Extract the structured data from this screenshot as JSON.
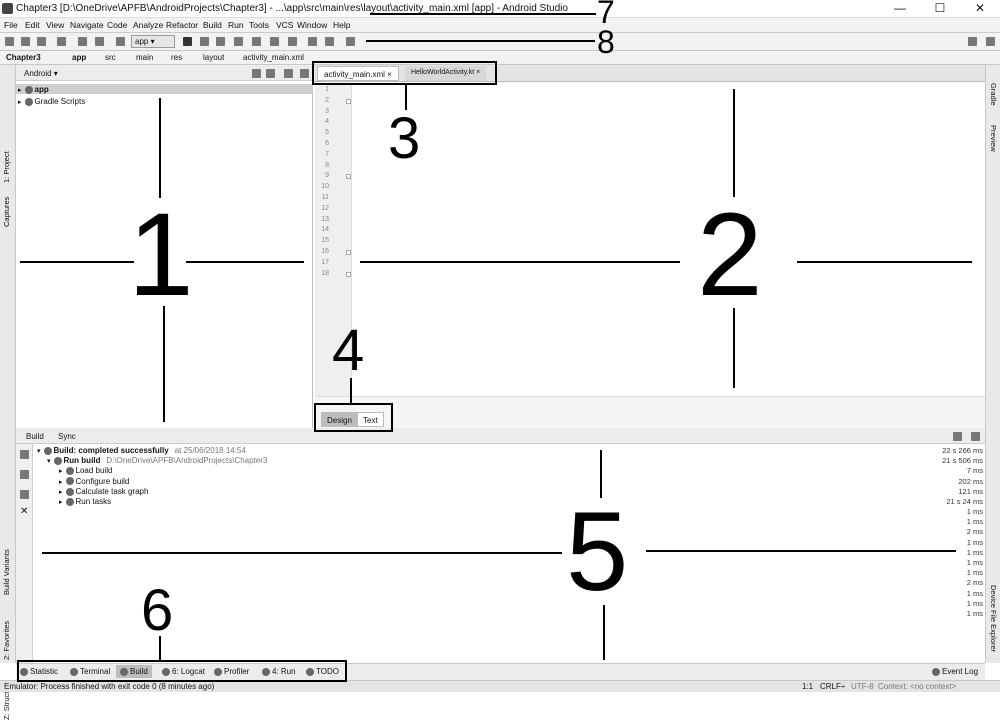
{
  "title_bar": {
    "title": "Chapter3 [D:\\OneDrive\\APFB\\AndroidProjects\\Chapter3] - ...\\app\\src\\main\\res\\layout\\activity_main.xml [app] - Android Studio",
    "minimize": "—",
    "maximize": "☐",
    "close": "✕"
  },
  "menu": [
    "File",
    "Edit",
    "View",
    "Navigate",
    "Code",
    "Analyze",
    "Refactor",
    "Build",
    "Run",
    "Tools",
    "VCS",
    "Window",
    "Help"
  ],
  "toolbar": {
    "app_selector": "app"
  },
  "breadcrumb": [
    "Chapter3",
    "app",
    "src",
    "main",
    "res",
    "layout",
    "activity_main.xml"
  ],
  "left_tools": [
    "1: Project",
    "Captures",
    "Build Variants",
    "2: Favorites",
    "Z: Structure"
  ],
  "right_tools": [
    "Gradle",
    "Preview",
    "Device File Explorer"
  ],
  "project": {
    "view_mode": "Android",
    "items": [
      "app",
      "Gradle Scripts"
    ]
  },
  "editor": {
    "tabs": [
      "activity_main.xml",
      "HelloWorldActivity.kt"
    ],
    "line_numbers": [
      "1",
      "2",
      "3",
      "4",
      "5",
      "6",
      "7",
      "8",
      "9",
      "10",
      "11",
      "12",
      "13",
      "14",
      "15",
      "16",
      "17",
      "18"
    ],
    "bottom_tabs": [
      "Design",
      "Text"
    ]
  },
  "build": {
    "tabs": [
      "Build",
      "Sync"
    ],
    "rows": [
      {
        "label": "Build: completed successfully",
        "extra": "at 25/06/2018 14:54",
        "time": "22 s 266 ms"
      },
      {
        "label": "Run build",
        "extra": "D:\\OneDrive\\APFB\\AndroidProjects\\Chapter3",
        "time": "21 s 506 ms"
      },
      {
        "label": "Load build",
        "extra": "",
        "time": "7 ms"
      },
      {
        "label": "Configure build",
        "extra": "",
        "time": "202 ms"
      },
      {
        "label": "Calculate task graph",
        "extra": "",
        "time": "121 ms"
      },
      {
        "label": "Run tasks",
        "extra": "",
        "time": "21 s 24 ms"
      }
    ],
    "extra_times": [
      "1 ms",
      "1 ms",
      "2 ms",
      "1 ms",
      "1 ms",
      "1 ms",
      "1 ms",
      "2 ms",
      "1 ms",
      "1 ms",
      "1 ms"
    ]
  },
  "bottom_tools": [
    "Statistic",
    "Terminal",
    "Build",
    "6: Logcat",
    "Profiler",
    "4: Run",
    "TODO"
  ],
  "event_log": "Event Log",
  "status": {
    "message": "Emulator: Process finished with exit code 0 (8 minutes ago)",
    "position": "1:1",
    "line_sep": "CRLF÷",
    "encoding": "UTF-8",
    "context": "Context: <no context>"
  },
  "annotations": [
    "1",
    "2",
    "3",
    "4",
    "5",
    "6",
    "7",
    "8"
  ]
}
